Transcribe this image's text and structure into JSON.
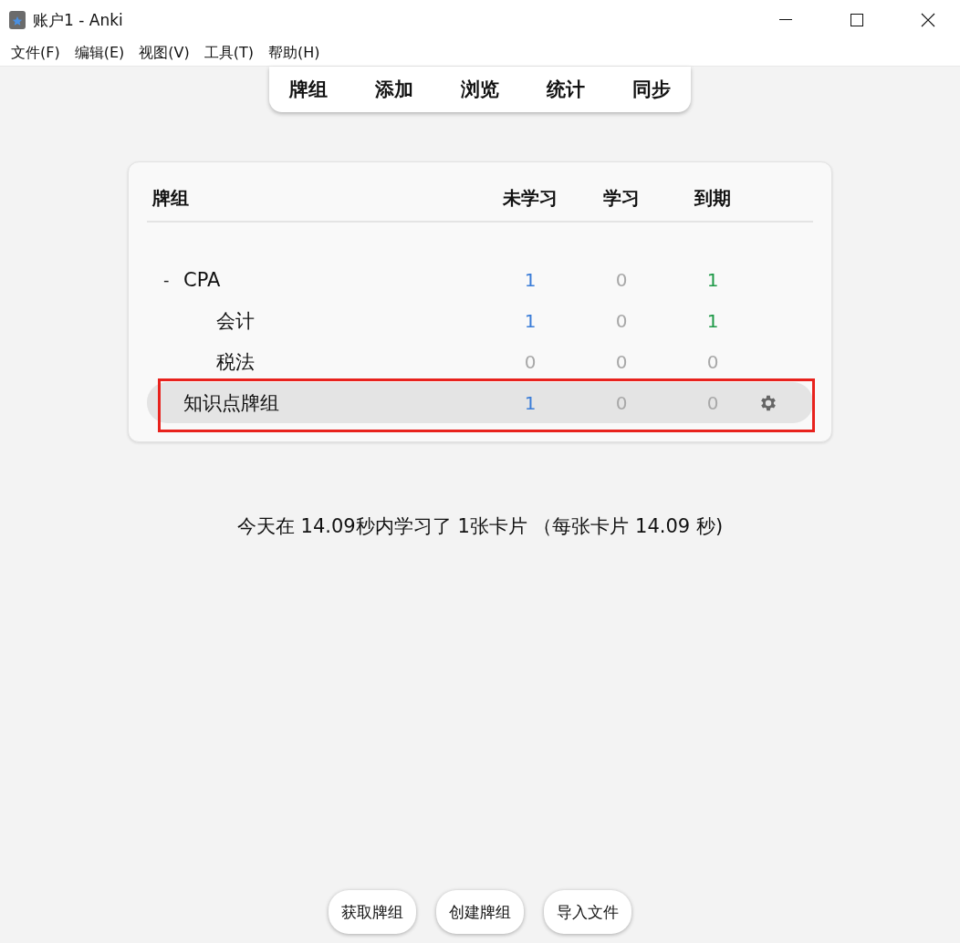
{
  "window": {
    "title": "账户1 - Anki"
  },
  "menu": [
    "文件(F)",
    "编辑(E)",
    "视图(V)",
    "工具(T)",
    "帮助(H)"
  ],
  "toolbar": [
    "牌组",
    "添加",
    "浏览",
    "统计",
    "同步"
  ],
  "deck_table": {
    "columns": [
      "牌组",
      "未学习",
      "学习",
      "到期"
    ],
    "rows": [
      {
        "name": "CPA",
        "expander": "-",
        "expanded": true,
        "selected": false,
        "marked": false,
        "counts": [
          {
            "value": "1",
            "color": "#3b7dd8"
          },
          {
            "value": "0",
            "color": "#a8a8a8"
          },
          {
            "value": "1",
            "color": "#1f9a48"
          }
        ],
        "children": [
          {
            "name": "会计",
            "selected": false,
            "marked": false,
            "counts": [
              {
                "value": "1",
                "color": "#3b7dd8"
              },
              {
                "value": "0",
                "color": "#a8a8a8"
              },
              {
                "value": "1",
                "color": "#1f9a48"
              }
            ]
          },
          {
            "name": "税法",
            "selected": false,
            "marked": false,
            "counts": [
              {
                "value": "0",
                "color": "#a8a8a8"
              },
              {
                "value": "0",
                "color": "#a8a8a8"
              },
              {
                "value": "0",
                "color": "#a8a8a8"
              }
            ]
          }
        ]
      },
      {
        "name": "知识点牌组",
        "selected": true,
        "marked": true,
        "counts": [
          {
            "value": "1",
            "color": "#3b7dd8"
          },
          {
            "value": "0",
            "color": "#a8a8a8"
          },
          {
            "value": "0",
            "color": "#a8a8a8"
          }
        ]
      }
    ]
  },
  "study_summary": "今天在 14.09秒内学习了 1张卡片 （每张卡片 14.09 秒)",
  "bottom_buttons": [
    "获取牌组",
    "创建牌组",
    "导入文件"
  ]
}
